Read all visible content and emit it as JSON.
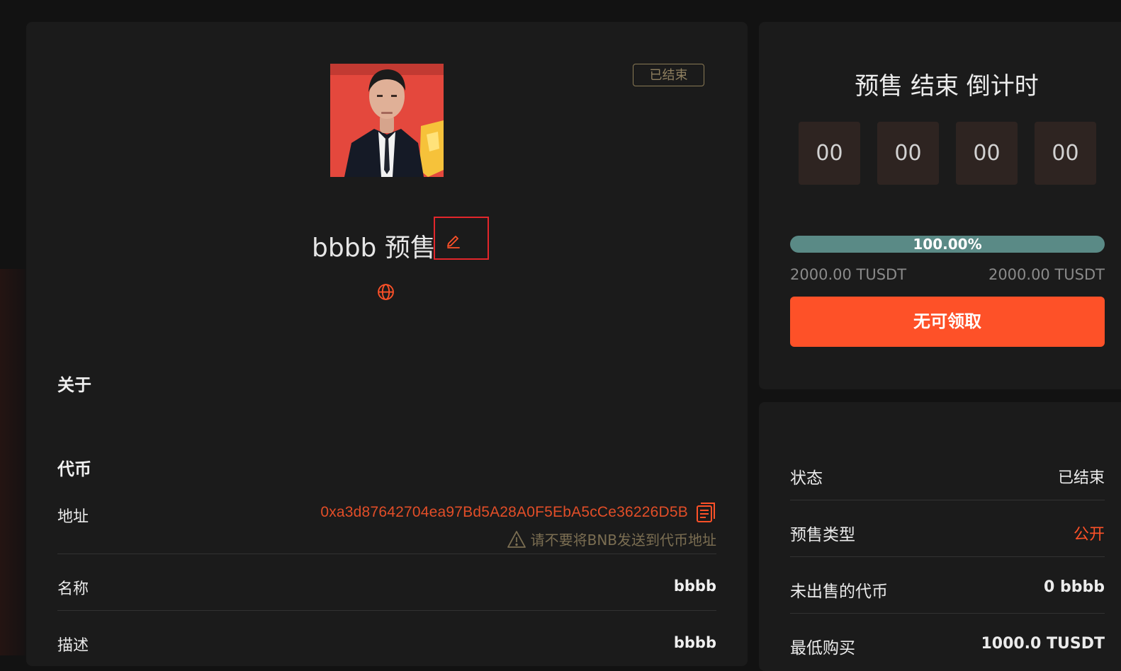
{
  "presale": {
    "status_badge": "已结束",
    "title": "bbbb 预售",
    "sections": {
      "about": "关于",
      "token": "代币"
    },
    "token": {
      "address_label": "地址",
      "address": "0xa3d87642704ea97Bd5A28A0F5EbA5cCe36226D5B",
      "warning": "请不要将BNB发送到代币地址",
      "name_label": "名称",
      "name": "bbbb",
      "description_label": "描述",
      "description": "bbbb"
    }
  },
  "countdown": {
    "title": "预售 结束 倒计时",
    "days": "00",
    "hours": "00",
    "minutes": "00",
    "seconds": "00",
    "progress_percent": 100,
    "progress_label": "100.00%",
    "raised": "2000.00 TUSDT",
    "hardcap": "2000.00 TUSDT",
    "claim_button": "无可领取"
  },
  "details": [
    {
      "label": "状态",
      "value": "已结束",
      "accent": false
    },
    {
      "label": "预售类型",
      "value": "公开",
      "accent": true
    },
    {
      "label": "未出售的代币",
      "value": "0 bbbb",
      "accent": false
    },
    {
      "label": "最低购买",
      "value": "1000.0 TUSDT",
      "accent": false
    }
  ],
  "colors": {
    "accent": "#fe5128",
    "address": "#e24e28",
    "badge": "#8e7f5f",
    "progress": "#5a8a86"
  },
  "icons": [
    "edit-icon",
    "globe-icon",
    "copy-icon",
    "warning-icon"
  ]
}
